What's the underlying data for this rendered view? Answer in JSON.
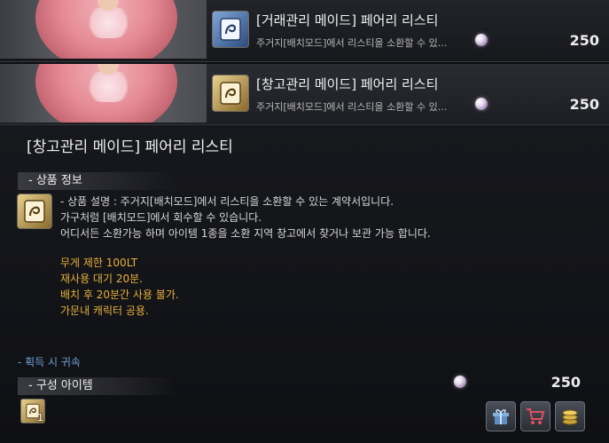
{
  "store_rows": [
    {
      "title": "[거래관리 메이드] 페어리 리스티",
      "description": "주거지[배치모드]에서 리스티을 소환할 수 있...",
      "price": "250",
      "icon": "scroll-icon-blue"
    },
    {
      "title": "[창고관리 메이드] 페어리 리스티",
      "description": "주거지[배치모드]에서 리스티을 소환할 수 있...",
      "price": "250",
      "icon": "scroll-icon-gold"
    }
  ],
  "detail": {
    "title": "[창고관리 메이드] 페어리 리스티",
    "product_info_header": "- 상품 정보",
    "description_lines": [
      "- 상품 설명 : 주거지[배치모드]에서 리스티을 소환할 수 있는 계약서입니다.",
      "가구처럼 [배치모드]에서  회수할 수 있습니다.",
      "어디서든 소환가능 하며 아이템 1종을 소환 지역 창고에서 찾거나 보관 가능 합니다."
    ],
    "attribute_lines": [
      "무게 제한 100LT",
      "재사용 대기 20분.",
      "배치 후 20분간 사용 불가.",
      "가문내 캐릭터 공용."
    ],
    "bind_note": "- 획득 시 귀속",
    "components_header": "- 구성 아이템",
    "component_count": "1",
    "price": "250"
  },
  "actions": {
    "gift_icon": "gift-icon",
    "cart_icon": "cart-icon",
    "coin_icon": "coin-stack-icon"
  },
  "colors": {
    "attribute_text": "#e6b13a",
    "bind_note": "#6fa3d6",
    "currency_pearl": "#e7d9ef"
  }
}
